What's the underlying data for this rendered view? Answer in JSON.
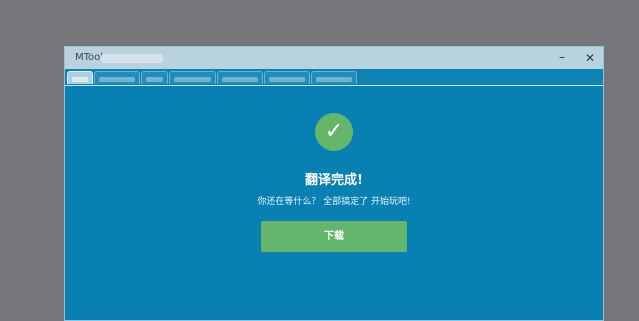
{
  "window": {
    "title": "MTool",
    "minimize_glyph": "–",
    "close_glyph": "✕"
  },
  "tabs": [
    {
      "label": "",
      "active": true
    },
    {
      "label": "",
      "active": false
    },
    {
      "label": "",
      "active": false
    },
    {
      "label": "",
      "active": false
    },
    {
      "label": "",
      "active": false
    },
    {
      "label": "",
      "active": false
    },
    {
      "label": "",
      "active": false
    }
  ],
  "main": {
    "status_icon": "check-circle-icon",
    "check_glyph": "✓",
    "heading": "翻译完成!",
    "message": "你还在等什么？ 全部搞定了 开始玩吧!",
    "download_label": "下载"
  },
  "colors": {
    "background": "#767579",
    "window_body": "#0880b3",
    "titlebar": "#b8d3de",
    "success_green": "#64b76a"
  }
}
